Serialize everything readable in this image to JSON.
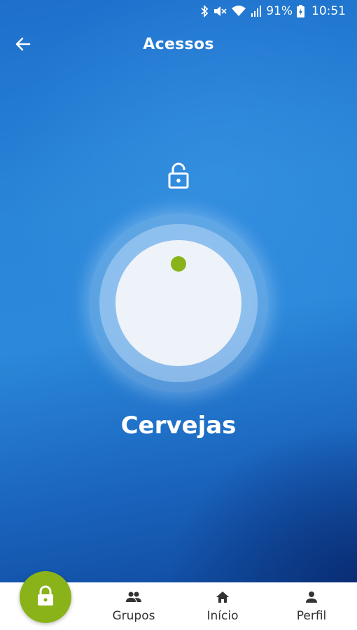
{
  "status_bar": {
    "battery": "91%",
    "time": "10:51",
    "icons": [
      "bluetooth-icon",
      "mute-icon",
      "wifi-icon",
      "signal-icon",
      "battery-icon"
    ]
  },
  "app_bar": {
    "title": "Acessos",
    "back_icon": "arrow-left-icon"
  },
  "access": {
    "lock_state_icon": "unlock-icon",
    "place_name": "Cervejas",
    "knob_color": "#eef3f9",
    "indicator_color": "#8ab31a"
  },
  "bottom_nav": {
    "fab_icon": "lock-icon",
    "fab_color": "#8ab31a",
    "items": [
      {
        "label": "Grupos",
        "icon": "group-icon"
      },
      {
        "label": "Início",
        "icon": "home-icon"
      },
      {
        "label": "Perfil",
        "icon": "person-icon"
      }
    ]
  }
}
